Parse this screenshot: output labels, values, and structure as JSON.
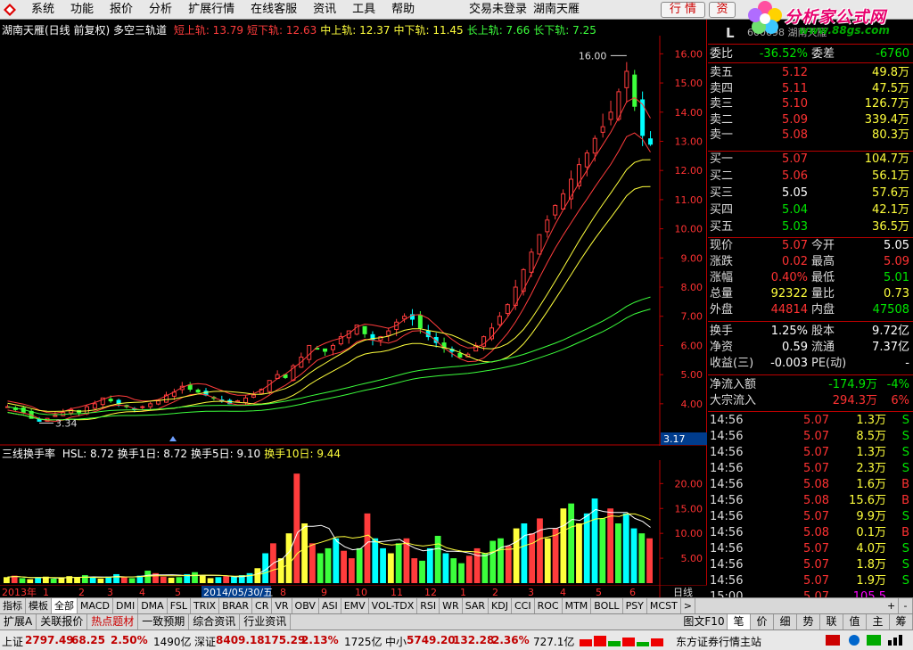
{
  "menu": {
    "items": [
      "系统",
      "功能",
      "报价",
      "分析",
      "扩展行情",
      "在线客服",
      "资讯",
      "工具",
      "帮助"
    ],
    "status": "交易未登录",
    "stock_name": "湖南天雁",
    "btn_quote": "行 情",
    "btn_info": "资"
  },
  "brand": {
    "title": "分析家公式网",
    "url": "www.88gs.com"
  },
  "main_title": {
    "name": "湖南天雁(日线 前复权) 多空三轨道",
    "lines": [
      {
        "label": "短上轨:",
        "value": "13.79",
        "color": "#ff3c3c"
      },
      {
        "label": "短下轨:",
        "value": "12.63",
        "color": "#ff3c3c"
      },
      {
        "label": "中上轨:",
        "value": "12.37",
        "color": "#ffff3c"
      },
      {
        "label": "中下轨:",
        "value": "11.45",
        "color": "#ffff3c"
      },
      {
        "label": "长上轨:",
        "value": "7.66",
        "color": "#3cff3c"
      },
      {
        "label": "长下轨:",
        "value": "7.25",
        "color": "#3cff3c"
      }
    ],
    "high_label": "16.00",
    "low_label": "3.34",
    "cur_label": "3.17"
  },
  "sub_title": {
    "name": "三线换手率",
    "items": [
      {
        "label": "HSL:",
        "value": "8.72",
        "color": "#ffffff"
      },
      {
        "label": "换手1日:",
        "value": "8.72",
        "color": "#ffffff"
      },
      {
        "label": "换手5日:",
        "value": "9.10",
        "color": "#ffffff"
      },
      {
        "label": "换手10日:",
        "value": "9.44",
        "color": "#ffff3c"
      }
    ]
  },
  "chart_data": [
    {
      "type": "candlestick",
      "title": "湖南天雁(日线 前复权) 多空三轨道",
      "ylim": [
        3.17,
        16.5
      ],
      "yticks": [
        "16.00",
        "15.00",
        "14.00",
        "13.00",
        "12.00",
        "11.00",
        "10.00",
        "9.00",
        "8.00",
        "7.00",
        "6.00",
        "5.00",
        "4.00"
      ],
      "close_path": [
        3.9,
        3.8,
        3.7,
        3.5,
        3.4,
        3.5,
        3.6,
        3.7,
        3.8,
        3.7,
        3.9,
        4.0,
        4.2,
        4.1,
        4.0,
        3.9,
        3.8,
        3.9,
        4.0,
        4.1,
        4.3,
        4.4,
        4.6,
        4.5,
        4.4,
        4.3,
        4.2,
        4.1,
        4.0,
        4.1,
        4.2,
        4.3,
        4.5,
        4.8,
        5.0,
        4.9,
        5.3,
        5.6,
        6.0,
        5.9,
        5.8,
        6.0,
        6.3,
        6.5,
        6.7,
        6.4,
        6.2,
        6.3,
        6.5,
        6.8,
        7.0,
        6.9,
        6.6,
        6.3,
        6.1,
        5.9,
        5.8,
        5.6,
        5.7,
        6.0,
        6.3,
        6.6,
        7.0,
        7.4,
        8.0,
        8.6,
        9.2,
        9.8,
        10.3,
        10.8,
        11.2,
        11.7,
        12.2,
        12.6,
        13.1,
        13.5,
        14.0,
        14.7,
        15.4,
        14.2,
        13.2,
        12.9
      ],
      "bands": [
        {
          "name": "短上轨",
          "color": "#ff3c3c",
          "end": 13.79
        },
        {
          "name": "短下轨",
          "color": "#ff3c3c",
          "end": 12.63
        },
        {
          "name": "中上轨",
          "color": "#ffff3c",
          "end": 12.37
        },
        {
          "name": "中下轨",
          "color": "#ffff3c",
          "end": 11.45
        },
        {
          "name": "长上轨",
          "color": "#3cff3c",
          "end": 7.66
        },
        {
          "name": "长下轨",
          "color": "#3cff3c",
          "end": 7.25
        }
      ]
    },
    {
      "type": "bar",
      "title": "三线换手率",
      "ylim": [
        0,
        24
      ],
      "yticks": [
        "20.00",
        "15.00",
        "10.00",
        "5.00"
      ],
      "values": [
        1.2,
        1.5,
        1.0,
        0.8,
        1.1,
        1.3,
        0.9,
        1.0,
        1.4,
        1.2,
        1.6,
        1.1,
        0.9,
        1.3,
        1.8,
        1.2,
        1.0,
        1.5,
        2.5,
        2.0,
        1.3,
        1.1,
        1.2,
        1.8,
        2.2,
        1.5,
        1.0,
        1.2,
        1.4,
        1.3,
        1.6,
        2.0,
        3.0,
        6.0,
        8.0,
        5.0,
        10.0,
        22.0,
        12.0,
        8.0,
        6.0,
        7.0,
        9.0,
        6.5,
        5.0,
        7.0,
        14.0,
        9.0,
        7.0,
        6.0,
        8.0,
        9.0,
        5.0,
        4.5,
        7.0,
        9.5,
        6.0,
        5.0,
        4.0,
        5.5,
        7.0,
        6.0,
        8.5,
        9.0,
        7.5,
        11.0,
        12.0,
        10.0,
        13.0,
        9.0,
        11.0,
        15.0,
        16.0,
        12.0,
        14.0,
        17.0,
        13.0,
        15.0,
        12.0,
        14.0,
        11.0,
        10.0,
        9.0
      ]
    }
  ],
  "timeline": {
    "labels": [
      {
        "text": "2013年",
        "highlight": false
      },
      {
        "text": "1",
        "highlight": false
      },
      {
        "text": "2",
        "highlight": false
      },
      {
        "text": "3",
        "highlight": false
      },
      {
        "text": "4",
        "highlight": false
      },
      {
        "text": "5",
        "highlight": false
      },
      {
        "text": "2014/05/30/五",
        "highlight": true
      },
      {
        "text": "8",
        "highlight": false
      },
      {
        "text": "9",
        "highlight": false
      },
      {
        "text": "10",
        "highlight": false
      },
      {
        "text": "11",
        "highlight": false
      },
      {
        "text": "12",
        "highlight": false
      },
      {
        "text": "1",
        "highlight": false
      },
      {
        "text": "2",
        "highlight": false
      },
      {
        "text": "3",
        "highlight": false
      },
      {
        "text": "4",
        "highlight": false
      },
      {
        "text": "5",
        "highlight": false
      },
      {
        "text": "6",
        "highlight": false
      }
    ],
    "period": "日线"
  },
  "tabs": [
    "指标",
    "模板",
    "全部",
    "MACD",
    "DMI",
    "DMA",
    "FSL",
    "TRIX",
    "BRAR",
    "CR",
    "VR",
    "OBV",
    "ASI",
    "EMV",
    "VOL-TDX",
    "RSI",
    "WR",
    "SAR",
    "KDJ",
    "CCI",
    "ROC",
    "MTM",
    "BOLL",
    "PSY",
    "MCST",
    ">"
  ],
  "tab_ctrls": [
    "+",
    "-"
  ],
  "lower_tabs": [
    "扩展A",
    "关联报价",
    "热点题材",
    "一致预期",
    "综合资讯",
    "行业资讯"
  ],
  "lower_right": [
    "图文F10",
    "笔",
    "价",
    "细",
    "势",
    "联",
    "值",
    "主",
    "筹"
  ],
  "rpanel": {
    "code_letter": "L",
    "code": "600698 湖南天雁",
    "weibi": {
      "label": "委比",
      "value": "-36.52%",
      "label2": "委差",
      "value2": "-6760"
    },
    "asks": [
      {
        "label": "卖五",
        "price": "5.12",
        "vol": "49.8万"
      },
      {
        "label": "卖四",
        "price": "5.11",
        "vol": "47.5万"
      },
      {
        "label": "卖三",
        "price": "5.10",
        "vol": "126.7万"
      },
      {
        "label": "卖二",
        "price": "5.09",
        "vol": "339.4万"
      },
      {
        "label": "卖一",
        "price": "5.08",
        "vol": "80.3万"
      }
    ],
    "bids": [
      {
        "label": "买一",
        "price": "5.07",
        "vol": "104.7万",
        "pc": "red"
      },
      {
        "label": "买二",
        "price": "5.06",
        "vol": "56.1万",
        "pc": "red"
      },
      {
        "label": "买三",
        "price": "5.05",
        "vol": "57.6万",
        "pc": "white"
      },
      {
        "label": "买四",
        "price": "5.04",
        "vol": "42.1万",
        "pc": "green"
      },
      {
        "label": "买五",
        "price": "5.03",
        "vol": "36.5万",
        "pc": "green"
      }
    ],
    "stats": [
      {
        "l": "现价",
        "v": "5.07",
        "vc": "red",
        "l2": "今开",
        "v2": "5.05",
        "v2c": "white"
      },
      {
        "l": "涨跌",
        "v": "0.02",
        "vc": "red",
        "l2": "最高",
        "v2": "5.09",
        "v2c": "red"
      },
      {
        "l": "涨幅",
        "v": "0.40%",
        "vc": "red",
        "l2": "最低",
        "v2": "5.01",
        "v2c": "green"
      },
      {
        "l": "总量",
        "v": "92322",
        "vc": "yellow",
        "l2": "量比",
        "v2": "0.73",
        "v2c": "yellow"
      },
      {
        "l": "外盘",
        "v": "44814",
        "vc": "red",
        "l2": "内盘",
        "v2": "47508",
        "v2c": "green"
      }
    ],
    "stats2": [
      {
        "l": "换手",
        "v": "1.25%",
        "vc": "white",
        "l2": "股本",
        "v2": "9.72亿",
        "v2c": "white"
      },
      {
        "l": "净资",
        "v": "0.59",
        "vc": "white",
        "l2": "流通",
        "v2": "7.37亿",
        "v2c": "white"
      },
      {
        "l": "收益(三)",
        "v": "-0.003",
        "vc": "white",
        "l2": "PE(动)",
        "v2": "-",
        "v2c": "white"
      }
    ],
    "flow": [
      {
        "l": "净流入额",
        "v": "-174.9万",
        "vc": "green",
        "p": "-4%",
        "pc": "green"
      },
      {
        "l": "大宗流入",
        "v": "294.3万",
        "vc": "red",
        "p": "6%",
        "pc": "red"
      }
    ],
    "ticks": [
      {
        "t": "14:56",
        "p": "5.07",
        "v": "1.3万",
        "b": "S",
        "vc": "yellow",
        "bc": "green"
      },
      {
        "t": "14:56",
        "p": "5.07",
        "v": "8.5万",
        "b": "S",
        "vc": "yellow",
        "bc": "green"
      },
      {
        "t": "14:56",
        "p": "5.07",
        "v": "1.3万",
        "b": "S",
        "vc": "yellow",
        "bc": "green"
      },
      {
        "t": "14:56",
        "p": "5.07",
        "v": "2.3万",
        "b": "S",
        "vc": "yellow",
        "bc": "green"
      },
      {
        "t": "14:56",
        "p": "5.08",
        "v": "1.6万",
        "b": "B",
        "vc": "yellow",
        "bc": "red"
      },
      {
        "t": "14:56",
        "p": "5.08",
        "v": "15.6万",
        "b": "B",
        "vc": "yellow",
        "bc": "red"
      },
      {
        "t": "14:56",
        "p": "5.07",
        "v": "9.9万",
        "b": "S",
        "vc": "yellow",
        "bc": "green"
      },
      {
        "t": "14:56",
        "p": "5.08",
        "v": "0.1万",
        "b": "B",
        "vc": "yellow",
        "bc": "red"
      },
      {
        "t": "14:56",
        "p": "5.07",
        "v": "4.0万",
        "b": "S",
        "vc": "yellow",
        "bc": "green"
      },
      {
        "t": "14:56",
        "p": "5.07",
        "v": "1.8万",
        "b": "S",
        "vc": "yellow",
        "bc": "green"
      },
      {
        "t": "14:56",
        "p": "5.07",
        "v": "1.9万",
        "b": "S",
        "vc": "yellow",
        "bc": "green"
      },
      {
        "t": "15:00",
        "p": "5.07",
        "v": "105.5万",
        "b": "",
        "vc": "magenta",
        "bc": "green"
      }
    ]
  },
  "ticker": {
    "sh_label": "上证",
    "sh_val": "2797.49",
    "sh_chg": "68.25",
    "sh_pct": "2.50%",
    "sh_amt": "1490亿",
    "sz_label": "深证",
    "sz_val": "8409.18",
    "sz_chg": "175.29",
    "sz_pct": "2.13%",
    "sz_amt": "1725亿",
    "zx_label": "中小",
    "zx_val": "5749.20",
    "zx_chg": "132.28",
    "zx_pct": "2.36%",
    "zx_amt": "727.1亿",
    "broker": "东方证券行情主站"
  }
}
